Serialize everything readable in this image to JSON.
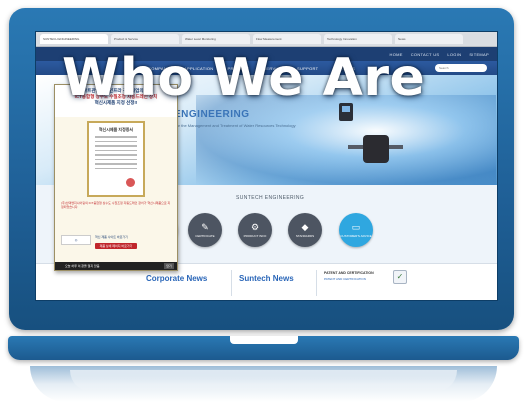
{
  "heading": "Who We Are",
  "browser": {
    "tabs": [
      "SUNTECH ENGINEERING",
      "Product & Service",
      "Water Level Monitoring",
      "Flow Measurement",
      "Technology Innovation",
      "News"
    ]
  },
  "site": {
    "util_links": [
      "HOME",
      "CONTACT US",
      "LOGIN",
      "SITEMAP"
    ],
    "menu": [
      "COMPANY",
      "APPLICATION",
      "PRODUCT",
      "SERVICE",
      "SUPPORT",
      "ABOUT US"
    ],
    "search_placeholder": "Search",
    "hero_title": "ENGINEERING",
    "hero_subtitle": "For the Management and Treatment of Water Resources Technology",
    "section_heading": "SUNTECH ENGINEERING",
    "circle_buttons": [
      {
        "label": "CERTIFICATE",
        "icon": "certificate-icon",
        "glyph": "✎"
      },
      {
        "label": "PRODUCT INFO",
        "icon": "gears-icon",
        "glyph": "⚙"
      },
      {
        "label": "STANDARDS",
        "icon": "shield-icon",
        "glyph": "◆"
      },
      {
        "label": "CUSTOMER'S ADVICE",
        "icon": "monitor-icon",
        "glyph": "▭"
      }
    ],
    "news": {
      "corporate": "Corporate News",
      "suntech": "Suntech News",
      "patent_title": "PATENT AND CERTIFICATION",
      "patent_sub": "PATENT AND CERTIFICATION"
    }
  },
  "popup": {
    "headline_1": "스마트관망관리 인프라 구축사업의 추축",
    "headline_2": "ICT융합형 상수도 수질조정 자동드레인 장치",
    "headline_3": "혁신시제품 지정 선정!!",
    "certificate_title": "혁신시제품 지정증서",
    "body": "(주)선텍엔지니어링의 ICT융합형 상수도 수질조정 자동드레인 장치가 혁신시제품으로 지정되었습니다.",
    "link_text": "혁신 제품 사이트 바로가기",
    "button": "제품 상세 페이지 바로가기",
    "footer": "오늘 하루 이 창을 열지 않음",
    "close": "닫기"
  },
  "colors": {
    "frame": "#2a79b4",
    "nav": "#1d3f73",
    "accent": "#2a66b8"
  }
}
